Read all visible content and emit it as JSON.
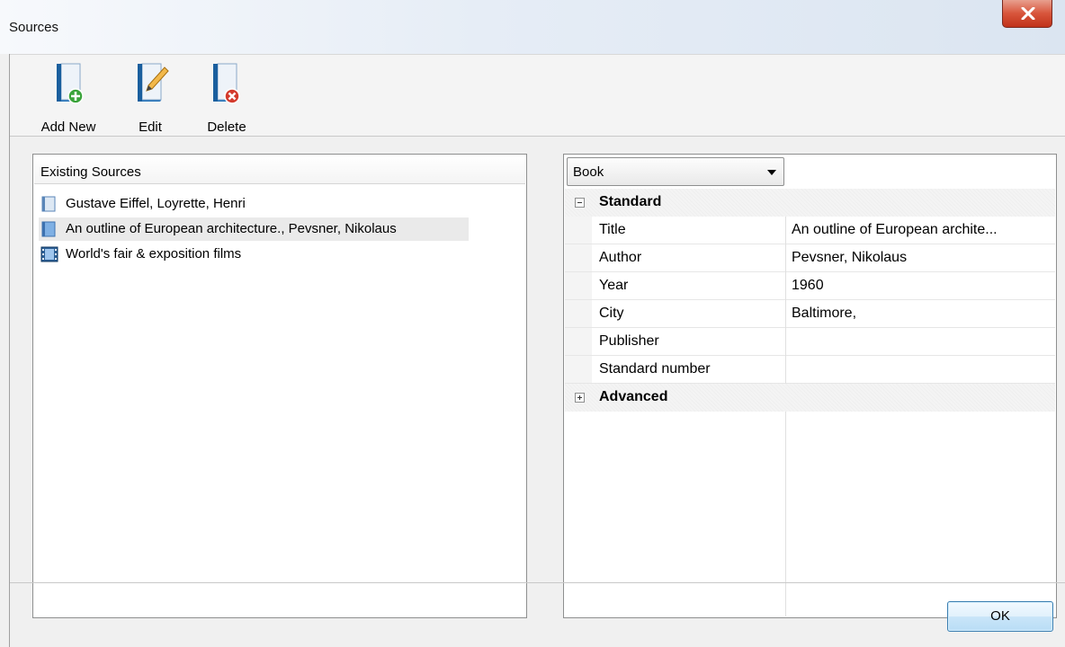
{
  "window": {
    "title": "Sources",
    "close_icon": "close-x-icon"
  },
  "toolbar": {
    "buttons": [
      {
        "label": "Add New",
        "icon": "book-add-icon"
      },
      {
        "label": "Edit",
        "icon": "book-edit-pencil-icon"
      },
      {
        "label": "Delete",
        "icon": "book-delete-icon"
      }
    ]
  },
  "sources_list": {
    "header": "Existing Sources",
    "items": [
      {
        "label": "Gustave Eiffel, Loyrette, Henri",
        "icon": "book-icon",
        "selected": false
      },
      {
        "label": "An outline of European architecture., Pevsner, Nikolaus",
        "icon": "book-icon",
        "selected": true
      },
      {
        "label": "World's fair & exposition films",
        "icon": "film-icon",
        "selected": false
      }
    ]
  },
  "details": {
    "type_select": {
      "value": "Book"
    },
    "categories": [
      {
        "label": "Standard",
        "expanded": true,
        "properties": [
          {
            "name": "Title",
            "value": "An outline of European archite..."
          },
          {
            "name": "Author",
            "value": "Pevsner, Nikolaus"
          },
          {
            "name": "Year",
            "value": "1960"
          },
          {
            "name": "City",
            "value": "Baltimore,"
          },
          {
            "name": "Publisher",
            "value": ""
          },
          {
            "name": "Standard number",
            "value": ""
          }
        ]
      },
      {
        "label": "Advanced",
        "expanded": false,
        "properties": []
      }
    ]
  },
  "footer": {
    "ok_label": "OK"
  },
  "colors": {
    "title_bar": "#dbe5f1",
    "close_button": "#c0321a",
    "selection": "#eaeaea",
    "ok_border": "#3c7fb1"
  }
}
